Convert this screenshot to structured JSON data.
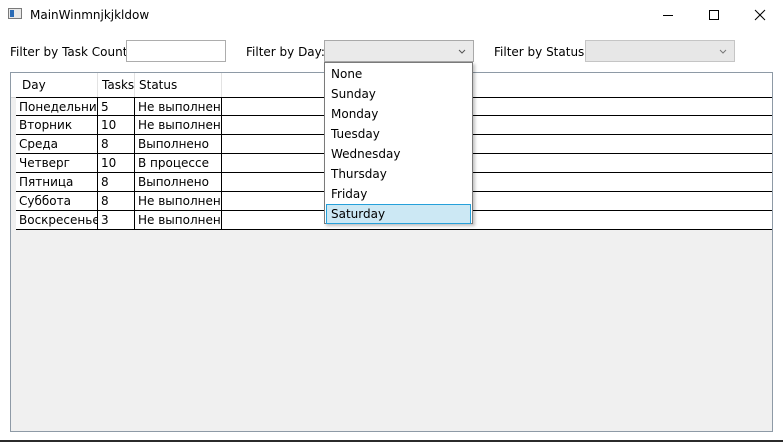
{
  "window": {
    "title": "MainWinmnjkjkldow"
  },
  "filters": {
    "task_count_label": "Filter by Task Count:",
    "task_count_value": "",
    "day_label": "Filter by Day:",
    "day_value": "",
    "status_label": "Filter by Status:",
    "status_value": ""
  },
  "grid": {
    "columns": [
      "Day",
      "Tasks",
      "Status"
    ],
    "rows": [
      [
        "Понедельник",
        "5",
        "Не выполнено"
      ],
      [
        "Вторник",
        "10",
        "Не выполнено"
      ],
      [
        "Среда",
        "8",
        "Выполнено"
      ],
      [
        "Четверг",
        "10",
        "В процессе"
      ],
      [
        "Пятница",
        "8",
        "Выполнено"
      ],
      [
        "Суббота",
        "8",
        "Не выполнено"
      ],
      [
        "Воскресенье",
        "3",
        "Не выполнено"
      ]
    ]
  },
  "day_dropdown": {
    "options": [
      "None",
      "Sunday",
      "Monday",
      "Tuesday",
      "Wednesday",
      "Thursday",
      "Friday",
      "Saturday"
    ],
    "highlighted": "Saturday"
  },
  "icons": {
    "app": "window-app-icon",
    "minimize": "minimize-icon",
    "maximize": "maximize-icon",
    "close": "close-icon",
    "chevron": "chevron-down-icon"
  },
  "colors": {
    "highlight_bg": "#cce8f4",
    "highlight_border": "#26a0da"
  }
}
